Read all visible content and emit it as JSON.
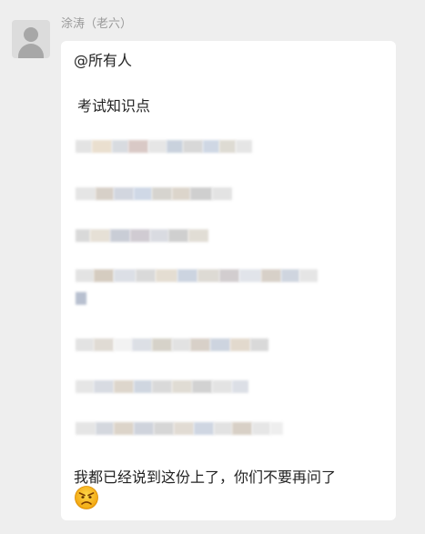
{
  "chat": {
    "sender_name": "涂涛（老六）",
    "message": {
      "mention": "@所有人",
      "title": "考试知识点",
      "closing": "我都已经说到这份上了，你们不要再问了"
    }
  },
  "icons": {
    "avatar": "default-user-avatar-icon",
    "emoji": "angry-face-emoji-icon"
  },
  "colors": {
    "background": "#eeeeee",
    "bubble": "#ffffff",
    "sender_text": "#9a9a9a",
    "message_text": "#222222"
  }
}
